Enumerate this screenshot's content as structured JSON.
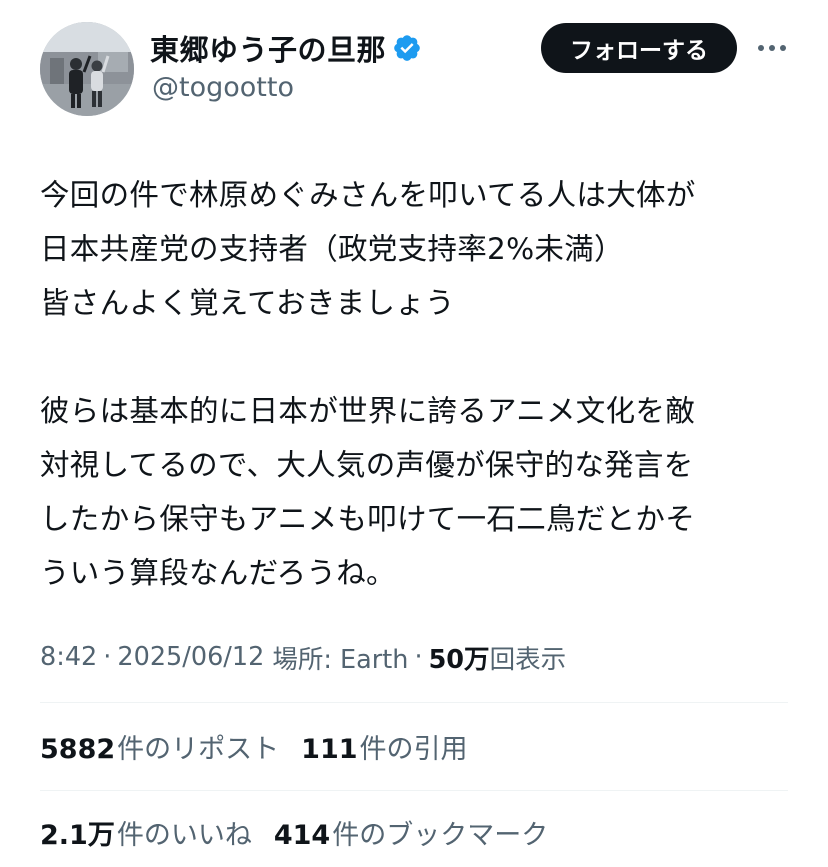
{
  "author": {
    "display_name": "東郷ゆう子の旦那",
    "handle": "@togootto",
    "verified": true
  },
  "actions": {
    "follow_label": "フォローする",
    "more_icon": "more-horizontal-icon"
  },
  "tweet": {
    "text": "今回の件で林原めぐみさんを叩いてる人は大体が\n日本共産党の支持者（政党支持率2%未満）\n皆さんよく覚えておきましょう\n\n彼らは基本的に日本が世界に誇るアニメ文化を敵\n対視してるので、大人気の声優が保守的な発言を\nしたから保守もアニメも叩けて一石二鳥だとかそ\nういう算段なんだろうね。",
    "time": "8:42",
    "date": "2025/06/12",
    "location_label": "場所: Earth",
    "views_count": "50万",
    "views_label": "回表示",
    "separator": "·"
  },
  "stats": {
    "reposts_count": "5882",
    "reposts_label": "件のリポスト",
    "quotes_count": "111",
    "quotes_label": "件の引用",
    "likes_count": "2.1万",
    "likes_label": "件のいいね",
    "bookmarks_count": "414",
    "bookmarks_label": "件のブックマーク"
  },
  "colors": {
    "text_primary": "#0f1419",
    "text_secondary": "#536471",
    "verified_blue": "#1d9bf0",
    "follow_bg": "#0f1419",
    "divider": "#eff3f4"
  }
}
